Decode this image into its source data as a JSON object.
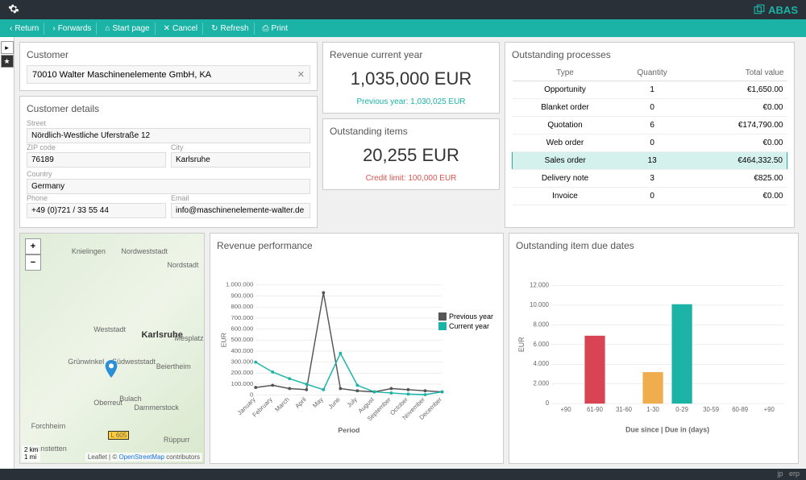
{
  "app": {
    "brand": "ABAS"
  },
  "toolbar": {
    "return": "Return",
    "forwards": "Forwards",
    "start": "Start page",
    "cancel": "Cancel",
    "refresh": "Refresh",
    "print": "Print"
  },
  "customer": {
    "title": "Customer",
    "value": "70010  Walter Maschinenelemente GmbH, KA"
  },
  "details": {
    "title": "Customer details",
    "street_label": "Street",
    "street": "Nördlich-Westliche Uferstraße 12",
    "zip_label": "ZIP code",
    "zip": "76189",
    "city_label": "City",
    "city": "Karlsruhe",
    "country_label": "Country",
    "country": "Germany",
    "phone_label": "Phone",
    "phone": "+49 (0)721 / 33 55 44",
    "email_label": "Email",
    "email": "info@maschinenelemente-walter.de"
  },
  "revenue": {
    "title": "Revenue current year",
    "value": "1,035,000 EUR",
    "prev": "Previous year: 1,030,025 EUR"
  },
  "outstanding_items": {
    "title": "Outstanding items",
    "value": "20,255 EUR",
    "credit": "Credit limit: 100,000 EUR"
  },
  "processes": {
    "title": "Outstanding processes",
    "headers": {
      "type": "Type",
      "qty": "Quantity",
      "total": "Total value"
    },
    "rows": [
      {
        "type": "Opportunity",
        "qty": "1",
        "total": "€1,650.00"
      },
      {
        "type": "Blanket order",
        "qty": "0",
        "total": "€0.00"
      },
      {
        "type": "Quotation",
        "qty": "6",
        "total": "€174,790.00"
      },
      {
        "type": "Web order",
        "qty": "0",
        "total": "€0.00"
      },
      {
        "type": "Sales order",
        "qty": "13",
        "total": "€464,332.50"
      },
      {
        "type": "Delivery note",
        "qty": "3",
        "total": "€825.00"
      },
      {
        "type": "Invoice",
        "qty": "0",
        "total": "€0.00"
      }
    ]
  },
  "map": {
    "scale1": "2 km",
    "scale2": "1 mi",
    "attribution_prefix": "Leaflet | © ",
    "attribution_link": "OpenStreetMap",
    "attribution_suffix": " contributors",
    "places": [
      "Knielingen",
      "Nordweststadt",
      "Nordstadt",
      "Weststadt",
      "Karlsruhe",
      "Grünwinkel",
      "Südweststadt",
      "Beiertheim",
      "Oberreut",
      "Forchheim",
      "heinstetten",
      "Dammerstock",
      "Rüppurr",
      "Bulach",
      "Mesplatz",
      "L 605"
    ]
  },
  "chart_data": [
    {
      "id": "revenue_perf",
      "title": "Revenue performance",
      "type": "line",
      "xlabel": "Period",
      "ylabel": "EUR",
      "ylim": [
        0,
        1000000
      ],
      "yticks": [
        "0",
        "100.000",
        "200.000",
        "300.000",
        "400.000",
        "500.000",
        "600.000",
        "700.000",
        "800.000",
        "900.000",
        "1.000.000"
      ],
      "categories": [
        "January",
        "February",
        "March",
        "April",
        "May",
        "June",
        "July",
        "August",
        "September",
        "October",
        "November",
        "December"
      ],
      "series": [
        {
          "name": "Previous year",
          "color": "#555555",
          "values": [
            70000,
            90000,
            60000,
            50000,
            930000,
            60000,
            40000,
            30000,
            60000,
            50000,
            40000,
            30000
          ]
        },
        {
          "name": "Current year",
          "color": "#1ab3a6",
          "values": [
            300000,
            210000,
            150000,
            100000,
            50000,
            380000,
            90000,
            30000,
            20000,
            10000,
            5000,
            30000
          ]
        }
      ]
    },
    {
      "id": "due_dates",
      "title": "Outstanding item due dates",
      "type": "bar",
      "xlabel": "Due since | Due in (days)",
      "ylabel": "EUR",
      "ylim": [
        0,
        12000
      ],
      "yticks": [
        "0",
        "2.000",
        "4.000",
        "6.000",
        "8.000",
        "10.000",
        "12.000"
      ],
      "categories": [
        "+90",
        "61-90",
        "31-60",
        "1-30",
        "0-29",
        "30-59",
        "60-89",
        "+90"
      ],
      "colors": [
        "#d94452",
        "#d94452",
        "#f0ad4e",
        "#f0ad4e",
        "#1ab3a6",
        "#1ab3a6",
        "#1ab3a6",
        "#1ab3a6"
      ],
      "values": [
        0,
        6900,
        0,
        3200,
        10100,
        0,
        0,
        0
      ]
    }
  ],
  "status": {
    "left": "jp",
    "right": "erp"
  }
}
